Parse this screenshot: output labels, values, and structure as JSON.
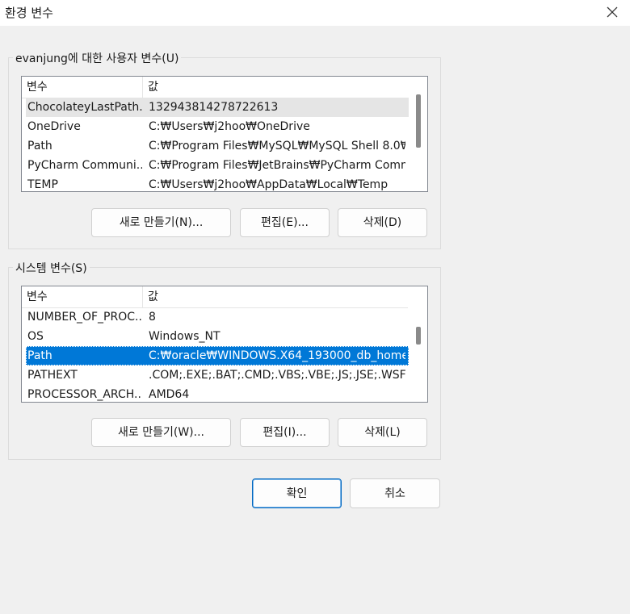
{
  "window": {
    "title": "환경 변수"
  },
  "user_group": {
    "label": "evanjung에 대한 사용자 변수(U)",
    "columns": [
      "변수",
      "값"
    ],
    "rows": [
      {
        "name": "ChocolateyLastPath...",
        "value": "132943814278722613"
      },
      {
        "name": "OneDrive",
        "value": "C:₩Users₩j2hoo₩OneDrive"
      },
      {
        "name": "Path",
        "value": "C:₩Program Files₩MySQL₩MySQL Shell 8.0₩..."
      },
      {
        "name": "PyCharm Communi...",
        "value": "C:₩Program Files₩JetBrains₩PyCharm Comm..."
      },
      {
        "name": "TEMP",
        "value": "C:₩Users₩j2hoo₩AppData₩Local₩Temp"
      }
    ],
    "buttons": {
      "new": "새로 만들기(N)...",
      "edit": "편집(E)...",
      "delete": "삭제(D)"
    }
  },
  "system_group": {
    "label": "시스템 변수(S)",
    "columns": [
      "변수",
      "값"
    ],
    "rows": [
      {
        "name": "NUMBER_OF_PROC...",
        "value": "8"
      },
      {
        "name": "OS",
        "value": "Windows_NT"
      },
      {
        "name": "Path",
        "value": "C:₩oracle₩WINDOWS.X64_193000_db_home..."
      },
      {
        "name": "PATHEXT",
        "value": ".COM;.EXE;.BAT;.CMD;.VBS;.VBE;.JS;.JSE;.WSF;..."
      },
      {
        "name": "PROCESSOR_ARCH...",
        "value": "AMD64"
      }
    ],
    "buttons": {
      "new": "새로 만들기(W)...",
      "edit": "편집(I)...",
      "delete": "삭제(L)"
    }
  },
  "footer": {
    "ok": "확인",
    "cancel": "취소"
  },
  "icons": {
    "close": "close-icon"
  },
  "colors": {
    "selection": "#0078d7",
    "hover_row": "#e5e5e5",
    "primary_border": "#0067c0"
  }
}
